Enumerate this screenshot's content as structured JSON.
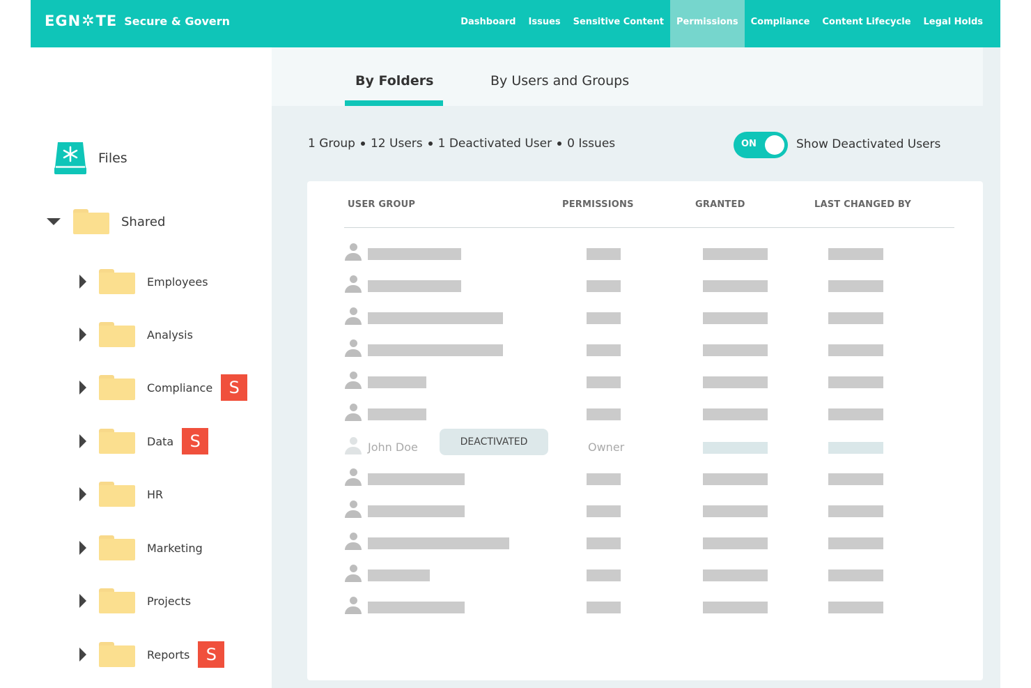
{
  "header": {
    "logo_part1": "EGN",
    "logo_part2": "TE",
    "logo_sub": "Secure & Govern",
    "nav": [
      {
        "label": "Dashboard"
      },
      {
        "label": "Issues"
      },
      {
        "label": "Sensitive Content"
      },
      {
        "label": "Permissions",
        "active": true
      },
      {
        "label": "Compliance"
      },
      {
        "label": "Content Lifecycle"
      },
      {
        "label": "Legal Holds"
      }
    ]
  },
  "sidebar": {
    "files_label": "Files",
    "shared_label": "Shared",
    "folders": [
      {
        "label": "Employees",
        "badge": ""
      },
      {
        "label": "Analysis",
        "badge": ""
      },
      {
        "label": "Compliance",
        "badge": "S"
      },
      {
        "label": "Data",
        "badge": "S"
      },
      {
        "label": "HR",
        "badge": ""
      },
      {
        "label": "Marketing",
        "badge": ""
      },
      {
        "label": "Projects",
        "badge": ""
      },
      {
        "label": "Reports",
        "badge": "S"
      }
    ]
  },
  "main": {
    "tabs": [
      {
        "label": "By Folders",
        "active": true
      },
      {
        "label": "By Users and Groups"
      }
    ],
    "summary": {
      "groups": "1 Group",
      "users": "12 Users",
      "deactivated": "1 Deactivated User",
      "issues": "0 Issues"
    },
    "toggle": {
      "state": "ON",
      "label": "Show Deactivated Users"
    },
    "table": {
      "headers": [
        "USER GROUP",
        "PERMISSIONS",
        "GRANTED",
        "LAST CHANGED BY"
      ],
      "deactivated_row": {
        "name": "John Doe",
        "badge": "DEACTIVATED",
        "permission": "Owner"
      }
    },
    "colors": {
      "accent": "#0fc5b8",
      "badge_red": "#f0503c",
      "folder": "#fbdf8f"
    }
  }
}
